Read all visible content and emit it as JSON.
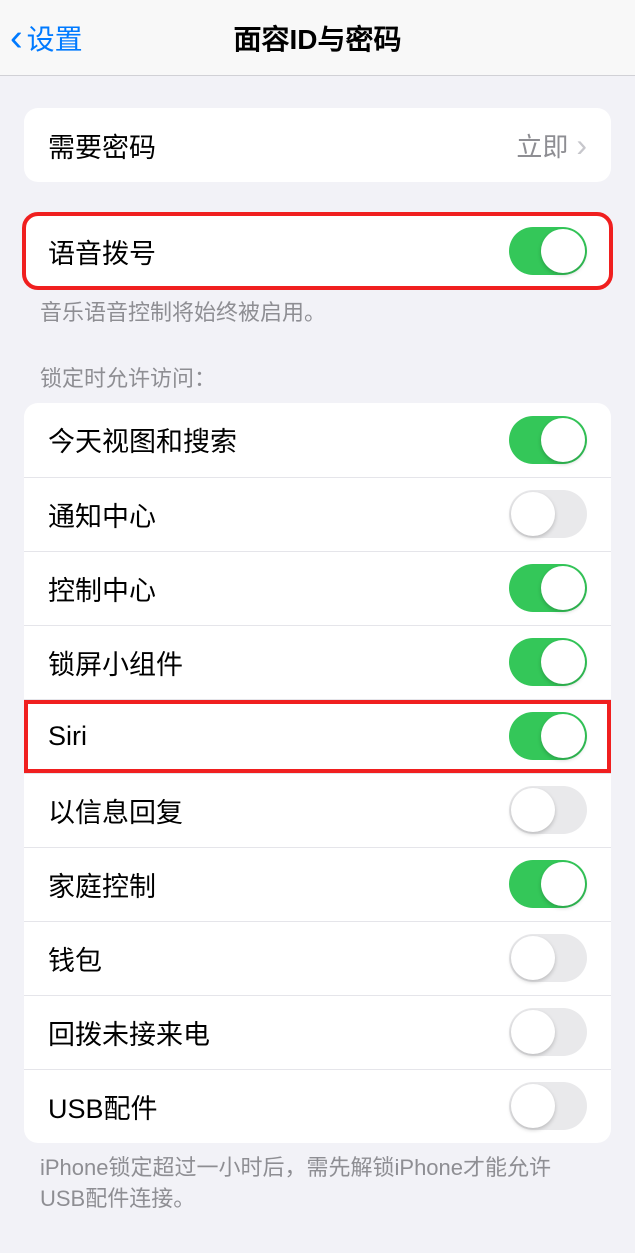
{
  "nav": {
    "back_label": "设置",
    "title": "面容ID与密码"
  },
  "require_passcode": {
    "label": "需要密码",
    "value": "立即"
  },
  "voice_dial": {
    "label": "语音拨号",
    "on": true,
    "footer": "音乐语音控制将始终被启用。"
  },
  "locked_access": {
    "header": "锁定时允许访问：",
    "items": [
      {
        "label": "今天视图和搜索",
        "on": true
      },
      {
        "label": "通知中心",
        "on": false
      },
      {
        "label": "控制中心",
        "on": true
      },
      {
        "label": "锁屏小组件",
        "on": true
      },
      {
        "label": "Siri",
        "on": true
      },
      {
        "label": "以信息回复",
        "on": false
      },
      {
        "label": "家庭控制",
        "on": true
      },
      {
        "label": "钱包",
        "on": false
      },
      {
        "label": "回拨未接来电",
        "on": false
      },
      {
        "label": "USB配件",
        "on": false
      }
    ],
    "footer": "iPhone锁定超过一小时后，需先解锁iPhone才能允许USB配件连接。"
  },
  "highlighted_items": [
    "语音拨号",
    "Siri"
  ]
}
